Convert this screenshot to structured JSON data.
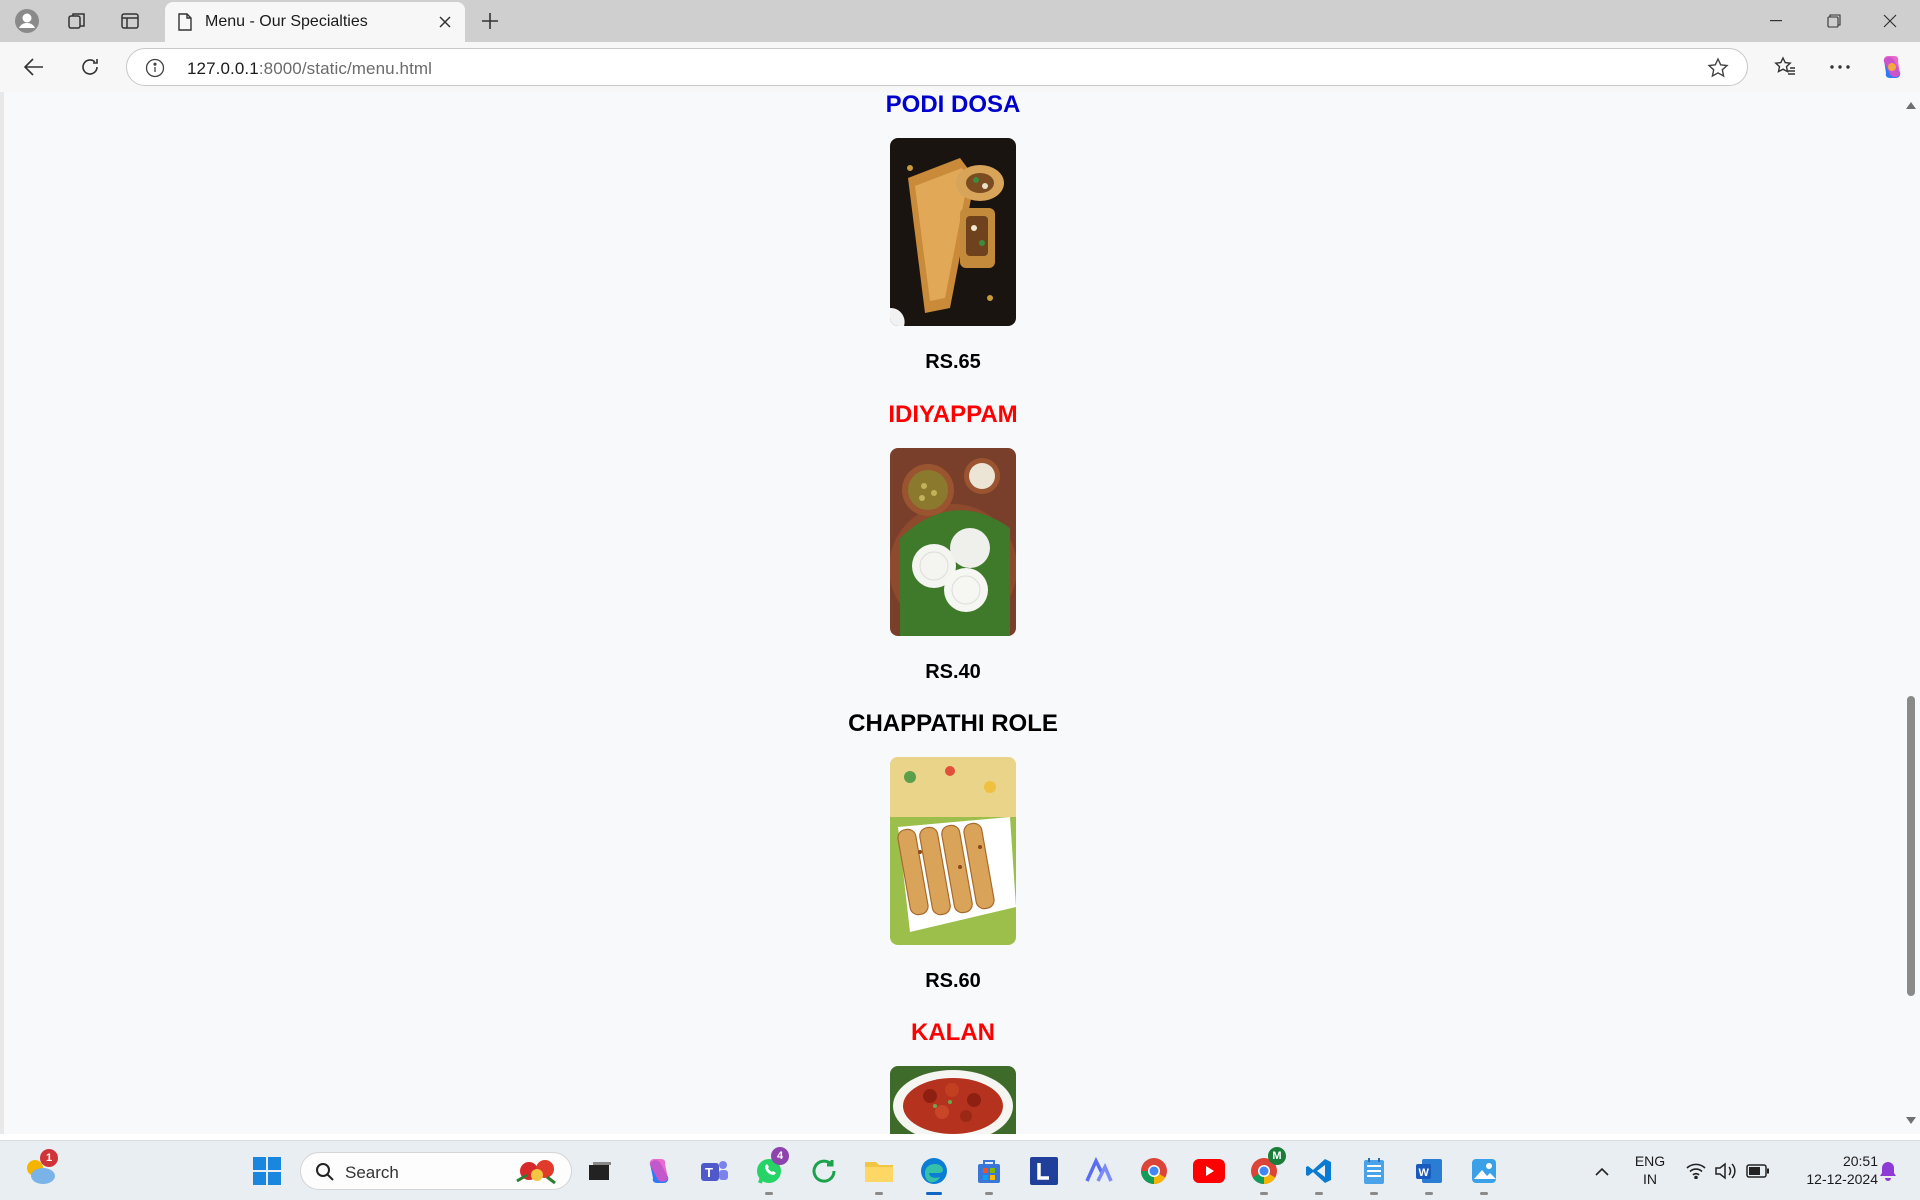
{
  "browser": {
    "tab_title": "Menu - Our Specialties",
    "url_host": "127.0.0.1",
    "url_rest": ":8000/static/menu.html"
  },
  "menu": {
    "items": [
      {
        "name": "PODI DOSA",
        "price": "RS.65",
        "color": "#0000cc",
        "image": "podi-dosa"
      },
      {
        "name": "IDIYAPPAM",
        "price": "RS.40",
        "color": "#ff0000",
        "image": "idiyappam"
      },
      {
        "name": "CHAPPATHI ROLE",
        "price": "RS.60",
        "color": "#000000",
        "image": "chappathi-role"
      },
      {
        "name": "KALAN",
        "color": "#ff0000",
        "image": "kalan"
      }
    ]
  },
  "taskbar": {
    "search_label": "Search",
    "weather_badge": "1",
    "whatsapp_badge": "4",
    "chrome_profile_badge": "M",
    "lang_line1": "ENG",
    "lang_line2": "IN",
    "time": "20:51",
    "date": "12-12-2024"
  }
}
